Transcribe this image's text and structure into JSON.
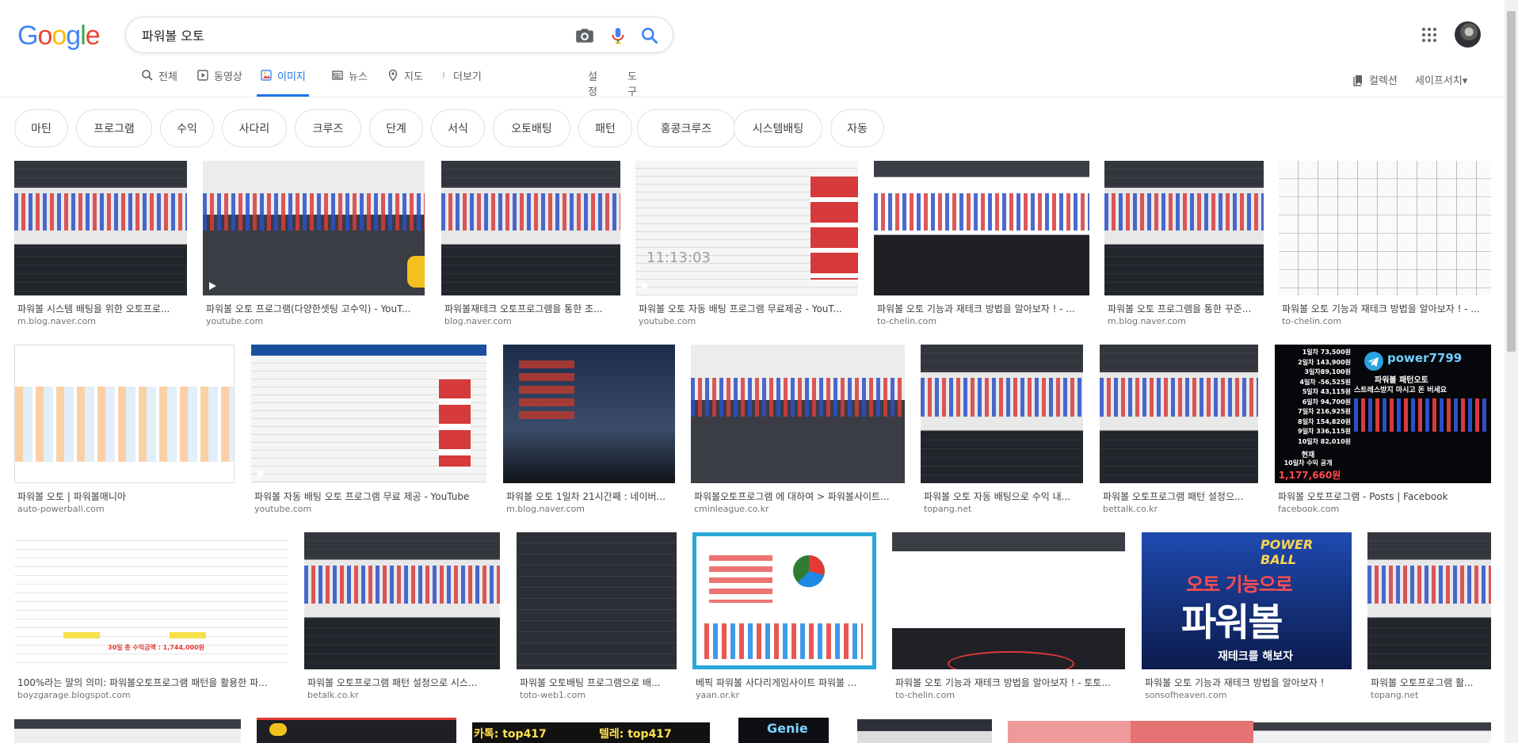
{
  "logo": {
    "letters": [
      "G",
      "o",
      "o",
      "g",
      "l",
      "e"
    ],
    "colors": [
      "#4285F4",
      "#EA4335",
      "#FBBC05",
      "#4285F4",
      "#34A853",
      "#EA4335"
    ]
  },
  "search": {
    "query": "파워볼 오토"
  },
  "tabs": {
    "all": "전체",
    "video": "동영상",
    "images": "이미지",
    "news": "뉴스",
    "maps": "지도",
    "more": "더보기",
    "settings": "설정",
    "tools": "도구"
  },
  "right_links": {
    "collections": "컬렉션",
    "safesearch": "세이프서치▾"
  },
  "chips": [
    "마틴",
    "프로그램",
    "수익",
    "사다리",
    "크루즈",
    "단계",
    "서식",
    "오토배팅",
    "패턴",
    "홍콩크루즈",
    "시스템배팅",
    "자동"
  ],
  "row1": [
    {
      "caption": "파워볼 시스템 배팅을 위한 오토프로...",
      "source": "m.blog.naver.com"
    },
    {
      "caption": "파워볼 오토 프로그램(다양한셋팅 고수익) - YouT...",
      "source": "youtube.com"
    },
    {
      "caption": "파워볼재테크 오토프로그램을 통한 조...",
      "source": "blog.naver.com"
    },
    {
      "caption": "파워볼 오토 자동 배팅 프로그램 무료제공 - YouT...",
      "source": "youtube.com",
      "overlay": "11:13:03"
    },
    {
      "caption": "파워볼 오토 기능과 재테크 방법을 알아보자 ! - ...",
      "source": "to-chelin.com"
    },
    {
      "caption": "파워볼 오토 프로그램을 통한 꾸준...",
      "source": "m.blog.naver.com"
    },
    {
      "caption": "파워볼 오토 기능과 재테크 방법을 알아보자 ! - ...",
      "source": "to-chelin.com"
    }
  ],
  "row2": [
    {
      "caption": "파워볼 오토 | 파워볼매니아",
      "source": "auto-powerball.com"
    },
    {
      "caption": "파워볼 자동 배팅 오토 프로그램 무료 제공 - YouTube",
      "source": "youtube.com"
    },
    {
      "caption": "파워볼 오토 1일차 21시간째 : 네이버...",
      "source": "m.blog.naver.com"
    },
    {
      "caption": "파워볼오토프로그램 에 대하여 > 파워볼사이트...",
      "source": "cminleague.co.kr"
    },
    {
      "caption": "파워볼 오토 자동 배팅으로 수익 내...",
      "source": "topang.net"
    },
    {
      "caption": "파워볼 오토프로그램 패턴 설정으...",
      "source": "bettalk.co.kr"
    },
    {
      "caption": "파워볼 오토프로그램 - Posts | Facebook",
      "source": "facebook.com",
      "overlay_title": "power7799",
      "overlay_sub1": "파워볼 패턴오토",
      "overlay_sub2": "스트레스받지 마시고 돈 버세요",
      "overlay_lines": [
        "1일차 73,500원",
        "2일차 143,900원",
        "3일차89,100원",
        "4일차 -56,525원",
        "5일차 43,115원",
        "6일차 94,700원",
        "7일차 216,925원",
        "8일차 154,820원",
        "9일차 336,115원",
        "10일차 82,010원"
      ],
      "overlay_now": "현재",
      "overlay_total_label": "10일차 수익 공개",
      "overlay_total": "1,177,660원"
    }
  ],
  "row3": [
    {
      "caption": "100%라는 말의 의미: 파워볼오토프로그램 패턴을 활용한 파...",
      "source": "boyzgarage.blogspot.com",
      "overlay": "30일 총 수익금액 : 1,744,000원"
    },
    {
      "caption": "파워볼 오토프로그램 패턴 설정으로 시스...",
      "source": "betalk.co.kr"
    },
    {
      "caption": "파워볼 오토배팅 프로그램으로 배...",
      "source": "toto-web1.com"
    },
    {
      "caption": "베픽 파워볼 사다리게임사이트 파워볼 ...",
      "source": "yaan.or.kr"
    },
    {
      "caption": "파워볼 오토 기능과 재테크 방법을 알아보자 ! - 토토...",
      "source": "to-chelin.com"
    },
    {
      "caption": "파워볼 오토 기능과 재테크 방법을 알아보자 !",
      "source": "sonsofheaven.com",
      "overlay_top": "POWER BALL",
      "overlay_mid": "오토 기능으로",
      "overlay_big": "파워볼",
      "overlay_bot": "재테크를 해보자"
    },
    {
      "caption": "파워볼 오토프로그램 활...",
      "source": "topang.net"
    }
  ],
  "row4": [
    {
      "overlay": ""
    },
    {
      "overlay": ""
    },
    {
      "overlay": "카톡: top417",
      "overlay2": "텔레: top417"
    },
    {
      "overlay": "Genie"
    },
    {
      "overlay": ""
    },
    {
      "overlay": ""
    },
    {
      "overlay": ""
    }
  ]
}
